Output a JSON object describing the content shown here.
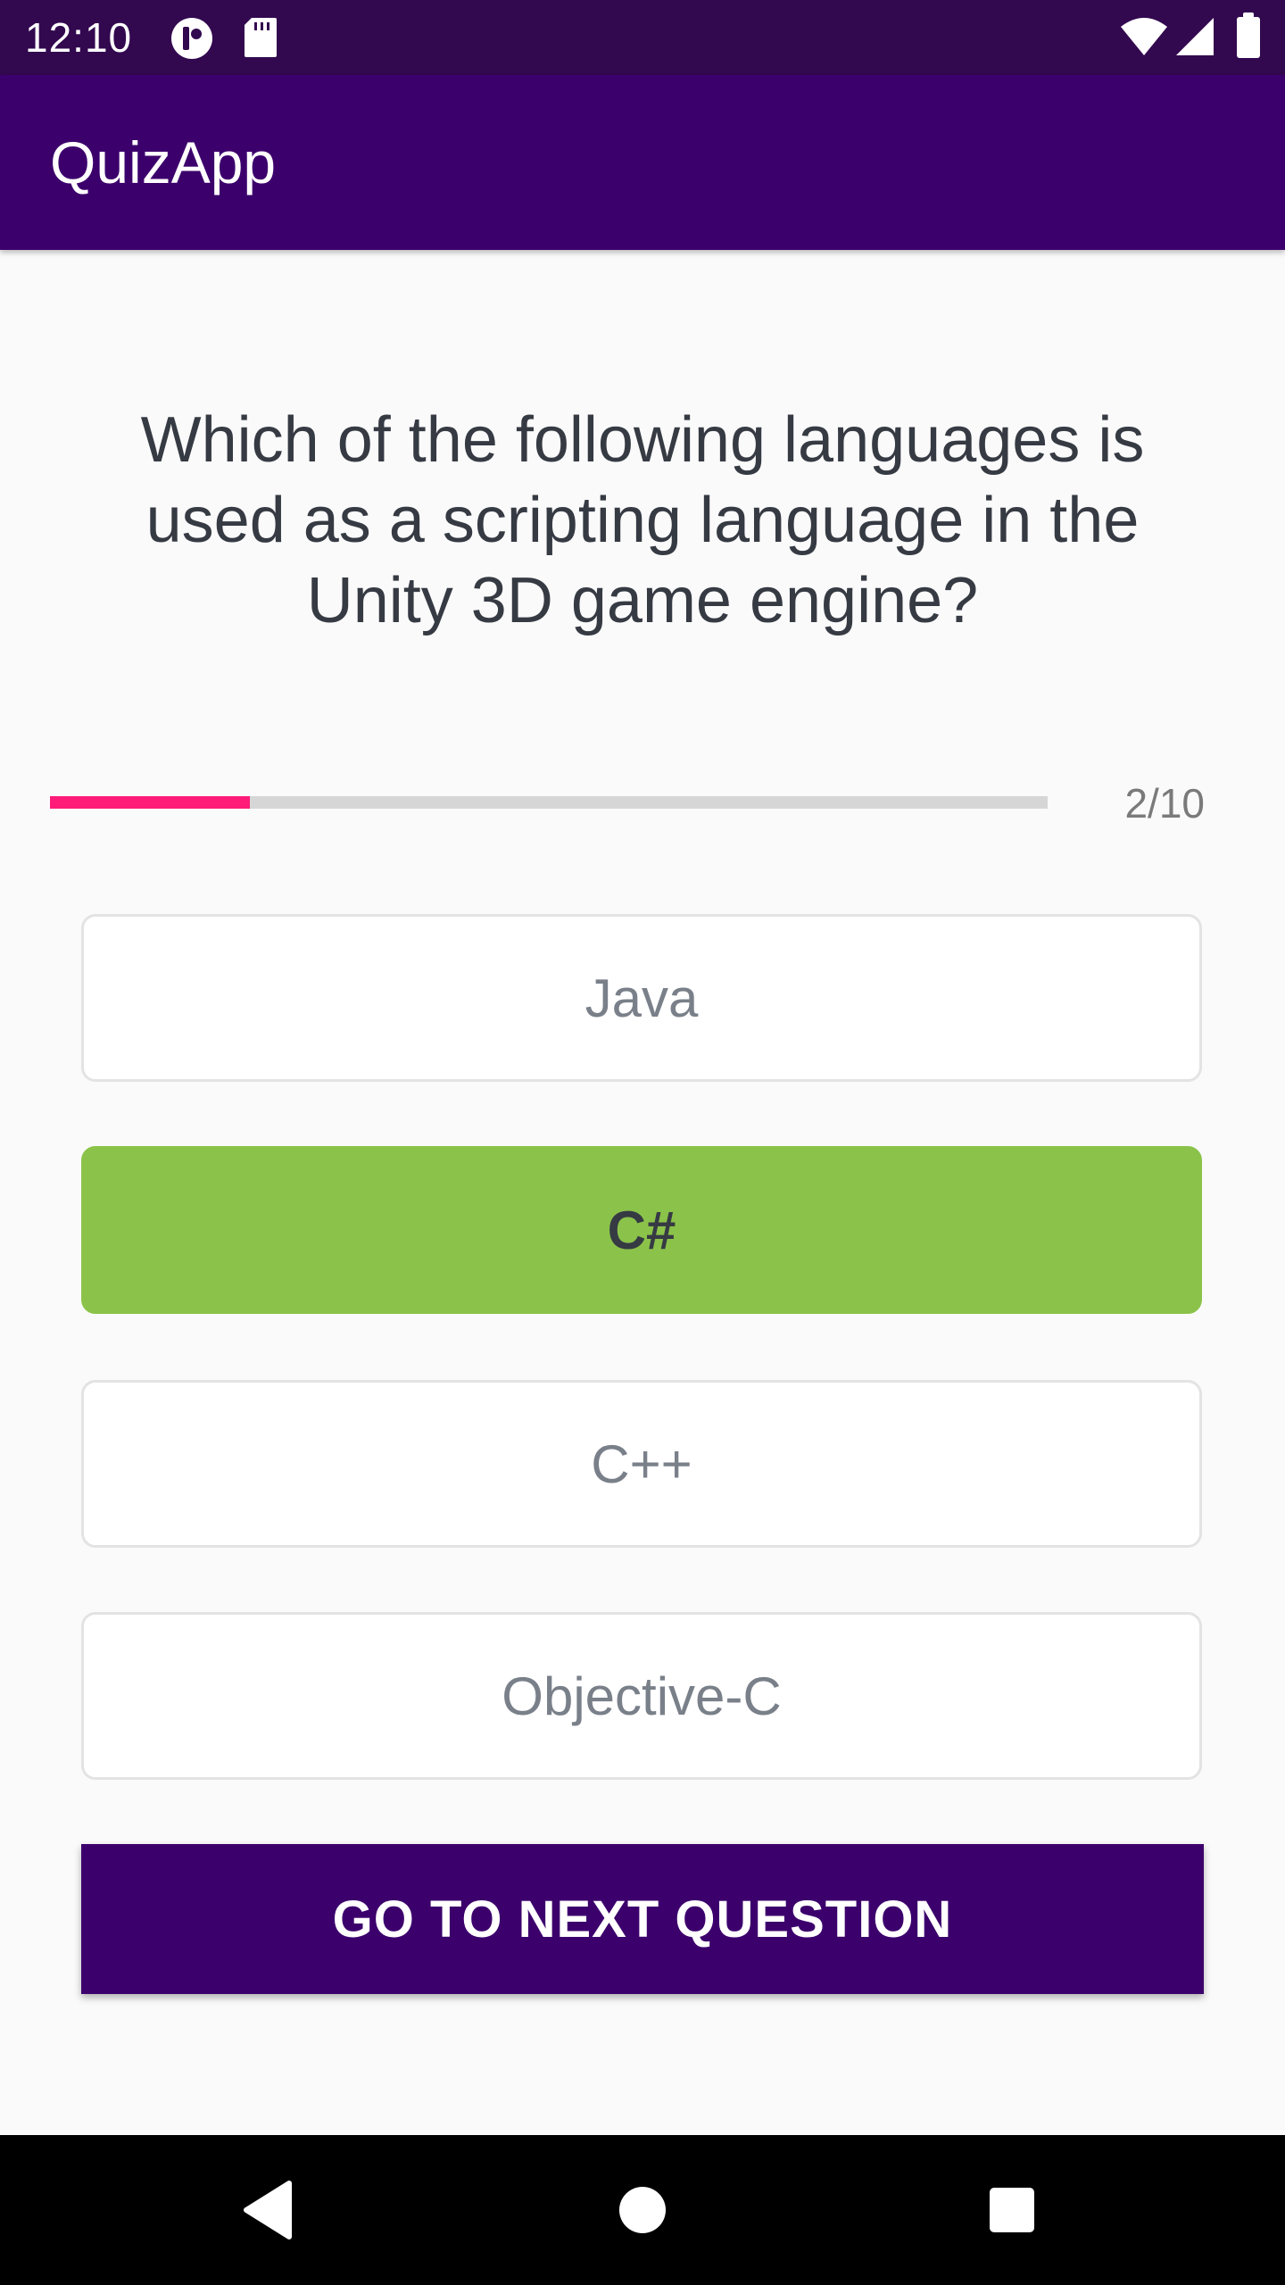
{
  "status_bar": {
    "time": "12:10",
    "icons": [
      "notification-app-icon",
      "sd-card-icon",
      "wifi-icon",
      "cellular-signal-icon",
      "battery-icon"
    ]
  },
  "app_bar": {
    "title": "QuizApp"
  },
  "quiz": {
    "question": "Which of the following languages is used as a scripting language in the Unity 3D game engine?",
    "progress": {
      "current": 2,
      "total": 10,
      "fraction": 0.2,
      "text": "2/10"
    },
    "options": [
      {
        "label": "Java",
        "selected": false
      },
      {
        "label": "C#",
        "selected": true
      },
      {
        "label": "C++",
        "selected": false
      },
      {
        "label": "Objective-C",
        "selected": false
      }
    ],
    "next_button_label": "GO TO NEXT QUESTION"
  },
  "nav_bar": {
    "icons": [
      "back-icon",
      "home-icon",
      "recents-icon"
    ]
  },
  "colors": {
    "primary": "#3C006C",
    "status_bar": "#32084F",
    "progress_fill": "#FF1B77",
    "correct_option": "#8BC34A",
    "question_text": "#363A43",
    "option_text": "#7A8089"
  }
}
